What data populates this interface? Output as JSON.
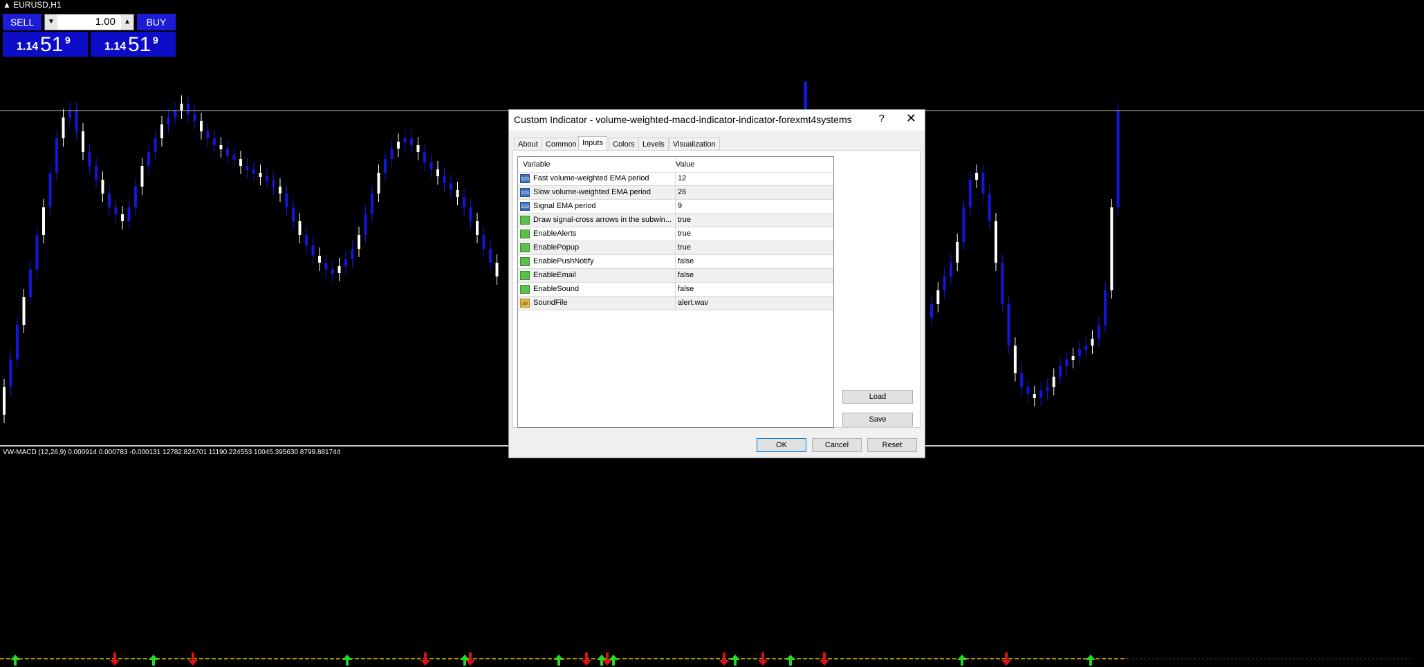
{
  "chart": {
    "symbol": "EURUSD,H1",
    "indicator_label": "VW-MACD (12,26,9) 0.000914 0.000783 -0.000131 12782.824701 11190.224553 10045.395630 8799.881744"
  },
  "trade_panel": {
    "sell_label": "SELL",
    "buy_label": "BUY",
    "lot_value": "1.00",
    "sell_quote": {
      "prefix": "1.14",
      "main": "51",
      "sup": "9"
    },
    "buy_quote": {
      "prefix": "1.14",
      "main": "51",
      "sup": "9"
    }
  },
  "dialog": {
    "title": "Custom Indicator - volume-weighted-macd-indicator-indicator-forexmt4systems",
    "help": "?",
    "close": "✕",
    "tabs": [
      "About",
      "Common",
      "Inputs",
      "Colors",
      "Levels",
      "Visualization"
    ],
    "active_tab": "Inputs",
    "grid": {
      "col_variable": "Variable",
      "col_value": "Value",
      "rows": [
        {
          "type": "num",
          "icon": "123",
          "name": "Fast volume-weighted EMA period",
          "value": "12"
        },
        {
          "type": "num",
          "icon": "123",
          "name": "Slow volume-weighted EMA period",
          "value": "26"
        },
        {
          "type": "num",
          "icon": "123",
          "name": "Signal EMA period",
          "value": "9"
        },
        {
          "type": "bool",
          "icon": "",
          "name": "Draw signal-cross arrows in the subwin...",
          "value": "true"
        },
        {
          "type": "bool",
          "icon": "",
          "name": "EnableAlerts",
          "value": "true"
        },
        {
          "type": "bool",
          "icon": "",
          "name": "EnablePopup",
          "value": "true"
        },
        {
          "type": "bool",
          "icon": "",
          "name": "EnablePushNotify",
          "value": "false"
        },
        {
          "type": "bool",
          "icon": "",
          "name": "EnableEmail",
          "value": "false"
        },
        {
          "type": "bool",
          "icon": "",
          "name": "EnableSound",
          "value": "false"
        },
        {
          "type": "str",
          "icon": "ab",
          "name": "SoundFile",
          "value": "alert.wav"
        }
      ]
    },
    "load_label": "Load",
    "save_label": "Save",
    "ok_label": "OK",
    "cancel_label": "Cancel",
    "reset_label": "Reset"
  }
}
